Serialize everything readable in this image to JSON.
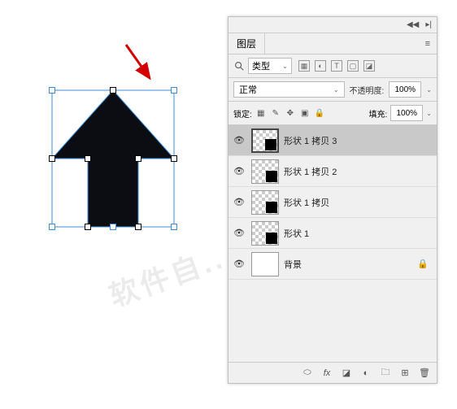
{
  "panel": {
    "tab_label": "图层",
    "filter_type": "类型",
    "blend_mode": "正常",
    "opacity_label": "不透明度:",
    "opacity_value": "100%",
    "lock_label": "锁定:",
    "fill_label": "填充:",
    "fill_value": "100%"
  },
  "filter_icons": [
    "▦",
    "◐",
    "T",
    "▢",
    "◪"
  ],
  "layers": [
    {
      "name": "形状 1 拷贝 3",
      "visible": true,
      "selected": true,
      "shape": true,
      "locked": false
    },
    {
      "name": "形状 1 拷贝 2",
      "visible": true,
      "selected": false,
      "shape": true,
      "locked": false
    },
    {
      "name": "形状 1 拷贝",
      "visible": true,
      "selected": false,
      "shape": true,
      "locked": false
    },
    {
      "name": "形状 1",
      "visible": true,
      "selected": false,
      "shape": true,
      "locked": false
    },
    {
      "name": "背景",
      "visible": true,
      "selected": false,
      "shape": false,
      "locked": true
    }
  ],
  "watermark": "软件自..."
}
